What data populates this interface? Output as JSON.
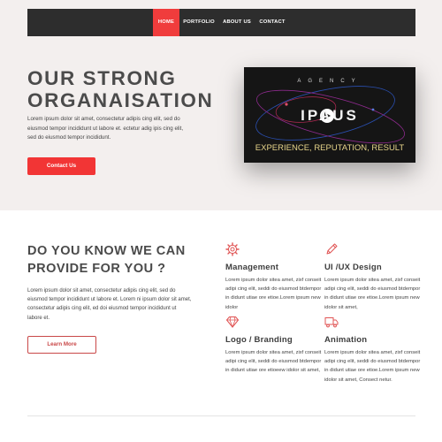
{
  "nav": {
    "items": [
      {
        "label": "HOME"
      },
      {
        "label": "PORTFOLIO"
      },
      {
        "label": "ABOUT US"
      },
      {
        "label": "CONTACT"
      }
    ]
  },
  "hero": {
    "title_line1": "OUR STRONG",
    "title_line2": "ORGANAISATION",
    "text": "Lorem ipsum dolor sit amet, consectetur adipis cing elit, sed do eiusmod tempor incididunt ut labore et. ectetur adig ipis cing elit, sed do eiusmod tempor incididunt.",
    "button_label": "Contact Us"
  },
  "video": {
    "top_text": "AGENCY",
    "brand_text": "IPAUS",
    "tagline": "EXPERIENCE, REPUTATION, RESULT"
  },
  "section2": {
    "title_line1": "DO YOU KNOW WE CAN",
    "title_line2": "PROVIDE FOR YOU ?",
    "text": "Lorem ipsum dolor sit amet, consectetur adipis cing elit, sed do eiusmod tempor incididunt ut labore et. Lorem ni ipsum dolor sit amet, consectetur adipis cing elit, ed doi eiusmod tempor incididunt ut labore et.",
    "button_label": "Learn More"
  },
  "features": {
    "management": {
      "title": "Management",
      "text": "Lorem ipsum dolor sitea amet, zixf conseit adipi cing elit, seddi do eiusmod btdempor in didunt utiae ore etioe.Lorem ipsum new idolor"
    },
    "ui_ux": {
      "title": "UI /UX Design",
      "text": "Lorem ipsum dolor sitea amet, zixf conseit adipi cing elit, seddi do eiusmod btdempor in didunt utiae ore etioe.Lorem ipsum new idolor sit amet,"
    },
    "logo_branding": {
      "title": "Logo / Branding",
      "text": "Lorem ipsum dolor sitea amet, zixf conseit adipi cing elit, seddi do eiusmod btdempor in didunt utiae ore etioeew idolor sit amet,"
    },
    "animation": {
      "title": "Animation",
      "text": "Lorem ipsum dolor sitea amet, zixf conseit adipi cing elit, seddi do eiusmod btdempor in didunt utiae ore etioe.Lorem ipsum new idolor sit amet, Consect netur."
    }
  },
  "colors": {
    "accent": "#f23535",
    "nav_bg": "#2d2d2d",
    "hero_bg": "#f3efee",
    "heading": "#4a4a4a",
    "tagline": "#e6d48a"
  },
  "icons": {
    "management": "gear-icon",
    "ui_ux": "pencil-icon",
    "logo_branding": "diamond-icon",
    "animation": "truck-icon",
    "video": "play-icon"
  }
}
